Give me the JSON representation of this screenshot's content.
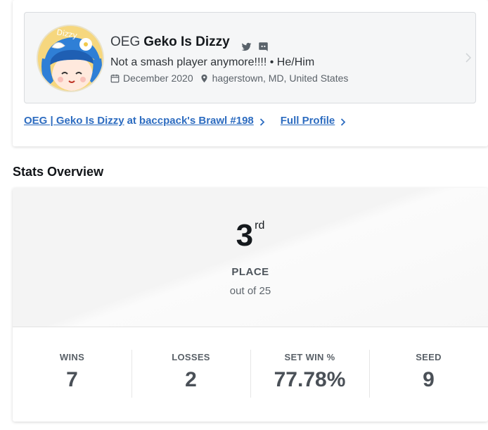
{
  "profile": {
    "prefix": "OEG",
    "gamertag": "Geko Is Dizzy",
    "avatar_text": "Dizzy",
    "bio": "Not a smash player anymore!!!! • He/Him",
    "joined": "December 2020",
    "location": "hagerstown, MD, United States",
    "social_icons": [
      "twitter-icon",
      "discord-icon"
    ]
  },
  "links": {
    "event_entrant": "OEG | Geko Is Dizzy",
    "event_at": "at",
    "event_name": "baccpack's Brawl #198",
    "full_profile": "Full Profile"
  },
  "stats_overview": {
    "title": "Stats Overview",
    "place": "3",
    "place_suffix": "rd",
    "place_label": "PLACE",
    "out_of": "out of 25",
    "items": [
      {
        "label": "WINS",
        "value": "7"
      },
      {
        "label": "LOSSES",
        "value": "2"
      },
      {
        "label": "SET WIN %",
        "value": "77.78%"
      },
      {
        "label": "SEED",
        "value": "9"
      }
    ]
  },
  "colors": {
    "link": "#2d6cc0",
    "text_dark": "#15191d",
    "muted": "#5c636a",
    "card_border": "#d9dcdf"
  }
}
